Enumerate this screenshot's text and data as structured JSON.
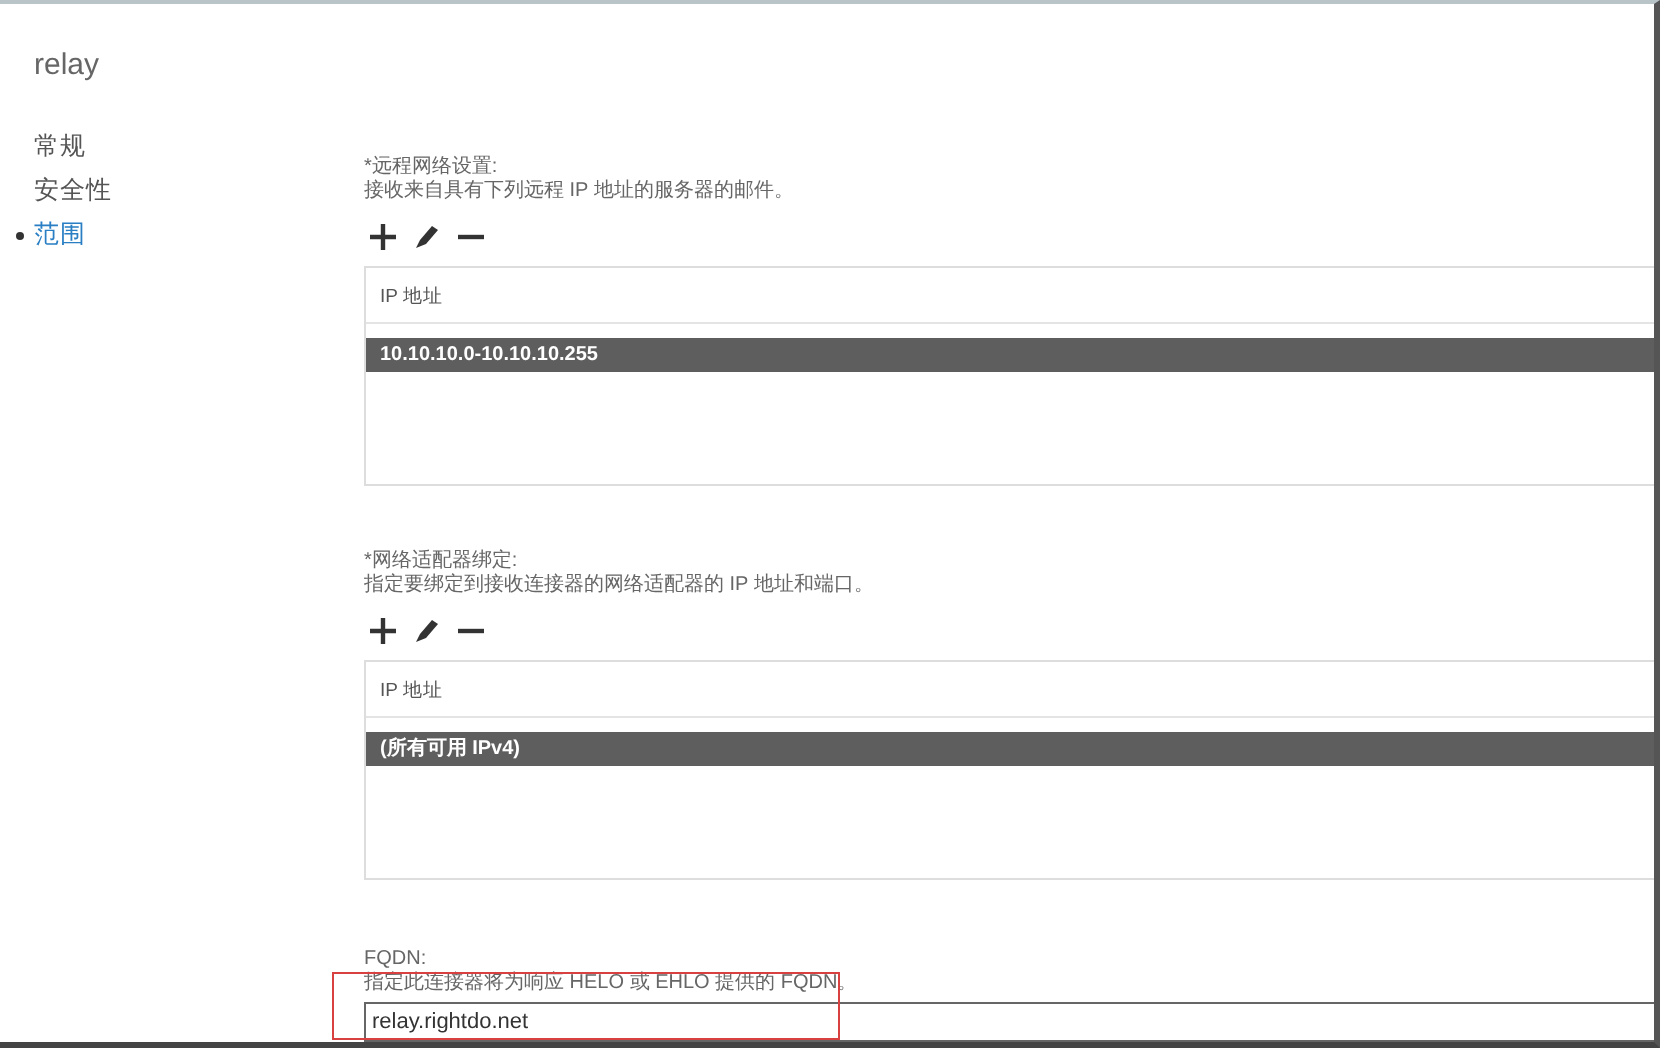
{
  "window": {
    "title": "relay"
  },
  "nav": {
    "items": [
      {
        "label": "常规",
        "selected": false
      },
      {
        "label": "安全性",
        "selected": false
      },
      {
        "label": "范围",
        "selected": true
      }
    ]
  },
  "sections": [
    {
      "kind": "list",
      "label": "*远程网络设置:",
      "description": "接收来自具有下列远程 IP 地址的服务器的邮件。",
      "column": "IP 地址",
      "rows": [
        {
          "text": "10.10.10.0-10.10.10.255",
          "selected": true
        }
      ]
    },
    {
      "kind": "list",
      "label": "*网络适配器绑定:",
      "description": "指定要绑定到接收连接器的网络适配器的 IP 地址和端口。",
      "column": "IP 地址",
      "rows": [
        {
          "text": "(所有可用 IPv4)",
          "selected": true
        }
      ]
    },
    {
      "kind": "field",
      "label": "FQDN:",
      "description": "指定此连接器将为响应 HELO 或 EHLO 提供的 FQDN。",
      "value": "relay.rightdo.net",
      "highlighted": true
    }
  ]
}
